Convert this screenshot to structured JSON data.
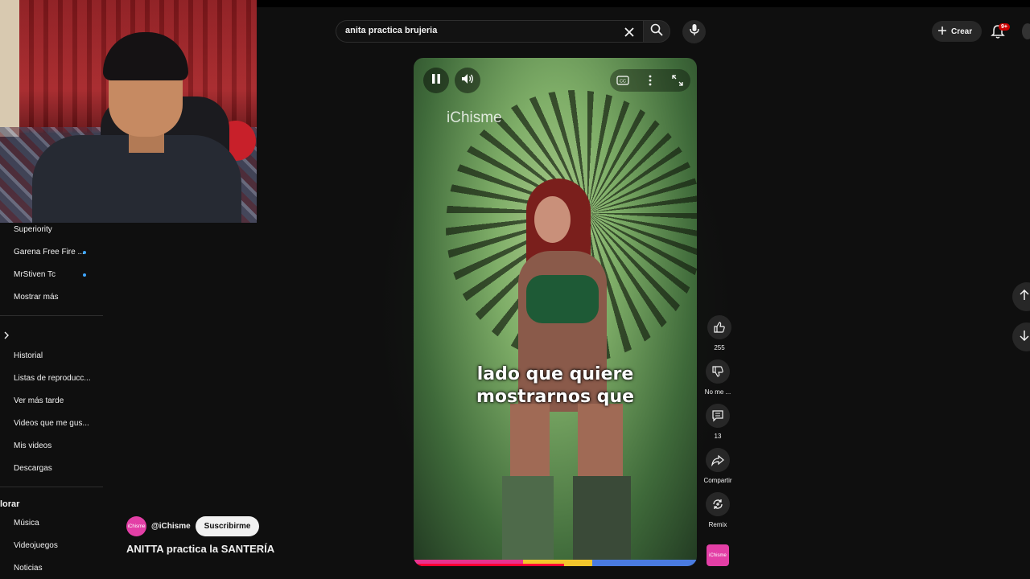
{
  "search": {
    "query": "anita practica brujeria"
  },
  "header": {
    "create_label": "Crear",
    "notif_badge": "9+"
  },
  "sidebar": {
    "subscriptions": [
      {
        "label": "Superiority",
        "dot": false
      },
      {
        "label": "Garena Free Fire ...",
        "dot": true
      },
      {
        "label": "MrStiven Tc",
        "dot": true
      },
      {
        "label": "Mostrar más",
        "dot": false
      }
    ],
    "you_items": [
      {
        "label": "Historial"
      },
      {
        "label": "Listas de reproducc..."
      },
      {
        "label": "Ver más tarde"
      },
      {
        "label": "Videos que me gus..."
      },
      {
        "label": "Mis videos"
      },
      {
        "label": "Descargas"
      }
    ],
    "explore_title": "lorar",
    "explore_items": [
      {
        "label": "Música"
      },
      {
        "label": "Videojuegos"
      },
      {
        "label": "Noticias"
      }
    ]
  },
  "short": {
    "channel_handle": "@iChisme",
    "channel_avatar_text": "iChisme",
    "subscribe_label": "Suscribirme",
    "title": "ANITTA practica la SANTERÍA",
    "watermark": "iChisme",
    "subtitle_line1": "lado que quiere",
    "subtitle_line2": "mostrarnos que",
    "progress_fraction": 0.53,
    "progress_colors": [
      "#e8338f",
      "#f2c62c",
      "#4a7be0"
    ],
    "like_count": "255",
    "dislike_label": "No me ...",
    "comment_count": "13",
    "share_label": "Compartir",
    "remix_label": "Remix"
  },
  "icons": [
    "close-icon",
    "search-icon",
    "mic-icon",
    "plus-icon",
    "bell-icon",
    "pause-icon",
    "volume-icon",
    "cc-icon",
    "more-vert-icon",
    "fullscreen-icon",
    "like-icon",
    "dislike-icon",
    "comment-icon",
    "share-icon",
    "remix-icon",
    "arrow-up-icon",
    "arrow-down-icon",
    "chevron-right-icon"
  ]
}
